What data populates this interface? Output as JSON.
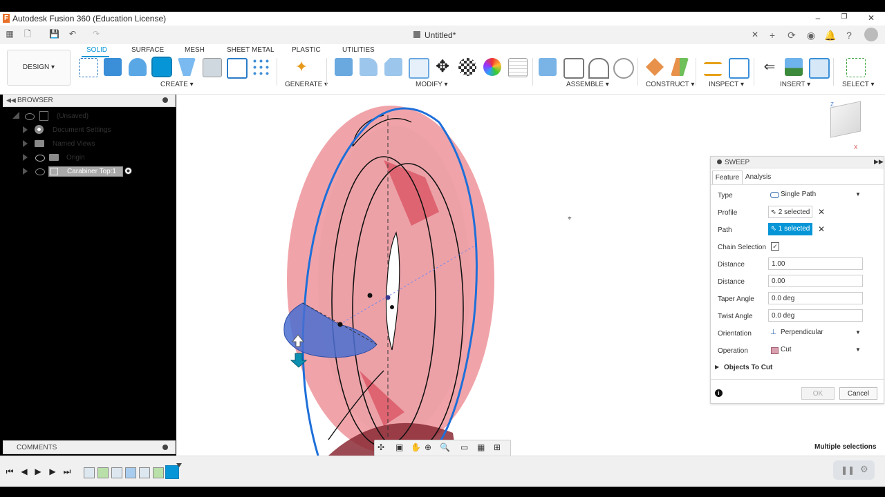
{
  "window": {
    "title": "Autodesk Fusion 360 (Education License)"
  },
  "document": {
    "tab_title": "Untitled*"
  },
  "workspace": {
    "design_label": "DESIGN"
  },
  "toolbar_tabs": [
    {
      "label": "SOLID"
    },
    {
      "label": "SURFACE"
    },
    {
      "label": "MESH"
    },
    {
      "label": "SHEET METAL"
    },
    {
      "label": "PLASTIC"
    },
    {
      "label": "UTILITIES"
    }
  ],
  "toolbar_groups": [
    {
      "label": "CREATE"
    },
    {
      "label": "GENERATE"
    },
    {
      "label": "MODIFY"
    },
    {
      "label": "ASSEMBLE"
    },
    {
      "label": "CONSTRUCT"
    },
    {
      "label": "INSPECT"
    },
    {
      "label": "INSERT"
    },
    {
      "label": "SELECT"
    }
  ],
  "browser": {
    "header": "BROWSER",
    "root": "(Unsaved)",
    "items": [
      {
        "label": "Document Settings"
      },
      {
        "label": "Named Views"
      },
      {
        "label": "Origin"
      },
      {
        "label": "Carabiner Top:1"
      }
    ]
  },
  "comments": {
    "label": "COMMENTS"
  },
  "sweep": {
    "title": "SWEEP",
    "tabs": [
      {
        "label": "Feature"
      },
      {
        "label": "Analysis"
      }
    ],
    "rows": {
      "type": {
        "label": "Type",
        "value": "Single Path"
      },
      "profile": {
        "label": "Profile",
        "value": "2 selected"
      },
      "path": {
        "label": "Path",
        "value": "1 selected"
      },
      "chain": {
        "label": "Chain Selection"
      },
      "distance1": {
        "label": "Distance",
        "value": "1.00"
      },
      "distance2": {
        "label": "Distance",
        "value": "0.00"
      },
      "taper": {
        "label": "Taper Angle",
        "value": "0.0 deg"
      },
      "twist": {
        "label": "Twist Angle",
        "value": "0.0 deg"
      },
      "orientation": {
        "label": "Orientation",
        "value": "Perpendicular"
      },
      "operation": {
        "label": "Operation",
        "value": "Cut"
      }
    },
    "objects_to_cut": "Objects To Cut",
    "ok": "OK",
    "cancel": "Cancel"
  },
  "status": {
    "text": "Multiple selections"
  },
  "colors": {
    "accent": "#0696d7",
    "body_fill": "#ec8a91",
    "path_blue": "#1e6fd9",
    "profile_blue": "#4a6fd0"
  }
}
